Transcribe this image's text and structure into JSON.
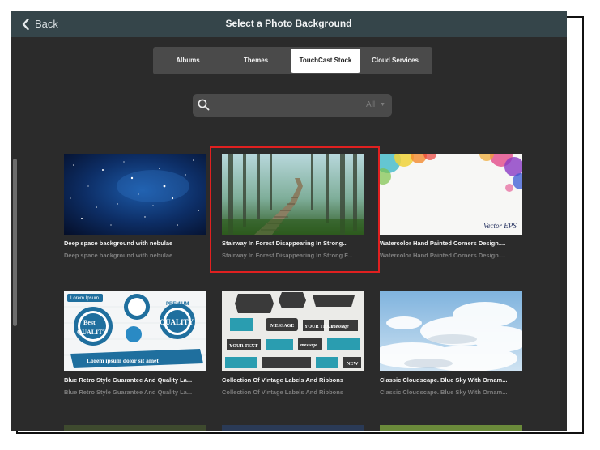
{
  "header": {
    "back_label": "Back",
    "title": "Select a Photo Background"
  },
  "tabs": [
    {
      "label": "Albums",
      "active": false
    },
    {
      "label": "Themes",
      "active": false
    },
    {
      "label": "TouchCast Stock",
      "active": true
    },
    {
      "label": "Cloud Services",
      "active": false
    }
  ],
  "search": {
    "value": "",
    "filter_label": "All"
  },
  "grid": {
    "items": [
      {
        "title": "Deep space background with nebulae",
        "subtitle": "Deep space background with nebulae",
        "image": "starry-space"
      },
      {
        "title": "Stairway In Forest Disappearing In Strong...",
        "subtitle": "Stairway In Forest Disappearing In Strong F...",
        "image": "forest-stairway",
        "selected": true
      },
      {
        "title": "Watercolor Hand Painted Corners Design....",
        "subtitle": "Watercolor Hand Painted Corners Design....",
        "image": "watercolor-corners",
        "badge": "Vector EPS"
      },
      {
        "title": "Blue Retro Style Guarantee And Quality La...",
        "subtitle": "Blue Retro Style Guarantee And Quality La...",
        "image": "retro-quality-labels",
        "badges": [
          "Best",
          "QUALITY",
          "Lorem Ipsum",
          "PREMIUM",
          "Lorem ipsum dolor sit amet"
        ]
      },
      {
        "title": "Collection Of Vintage Labels And Ribbons",
        "subtitle": "Collection Of Vintage Labels And Ribbons",
        "image": "vintage-labels",
        "badges": [
          "MESSAGE",
          "YOUR TEXT",
          "message",
          "YOUR TEXT",
          "message",
          "NEW"
        ]
      },
      {
        "title": "Classic Cloudscape. Blue Sky With Ornam...",
        "subtitle": "Classic Cloudscape. Blue Sky With Ornam...",
        "image": "cloudscape"
      }
    ]
  },
  "colors": {
    "titlebar": "#35454a",
    "background": "#2b2b2b",
    "selection": "#e02020"
  }
}
